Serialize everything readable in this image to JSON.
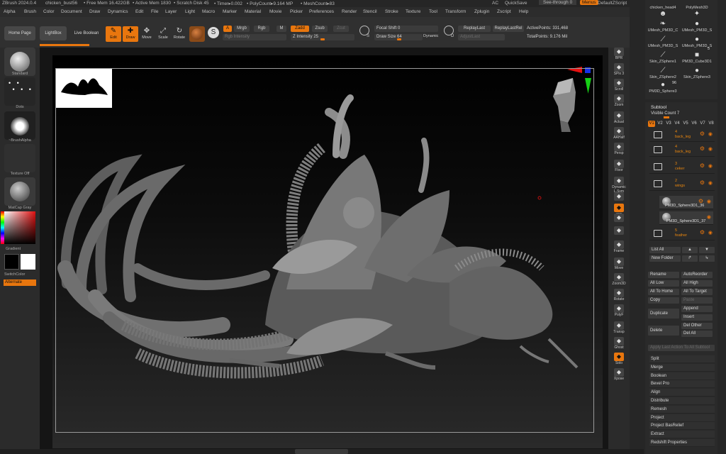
{
  "titlebar": {
    "app": "ZBrush 2024.0.4",
    "file": "chicken_bust56",
    "free_mem": "• Free Mem 16.422GB",
    "active_mem": "• Active Mem 1830",
    "scratch": "• Scratch Disk 45",
    "timer": "• Timer▸0.002",
    "polycount": "• PolyCount▸9.164 MP",
    "meshcount": "• MeshCount▸83",
    "ac": "AC",
    "quicksave": "QuickSave",
    "see_through": "See-through  0",
    "menus": "Menus",
    "zscript": "DefaultZScript"
  },
  "menubar": [
    "Alpha",
    "Brush",
    "Color",
    "Document",
    "Draw",
    "Dynamics",
    "Edit",
    "File",
    "Layer",
    "Light",
    "Macro",
    "Marker",
    "Material",
    "Movie",
    "Picker",
    "Preferences",
    "Render",
    "Stencil",
    "Stroke",
    "Texture",
    "Tool",
    "Transform",
    "Zplugin",
    "Zscript",
    "Help"
  ],
  "shelf": {
    "home_page": "Home Page",
    "lightbox": "LightBox",
    "live_boolean": "Live Boolean",
    "edit": "Edit",
    "draw": "Draw",
    "move": "Move",
    "scale": "Scale",
    "rotate": "Rotate",
    "a": "A",
    "mrgb": "Mrgb",
    "rgb": "Rgb",
    "m": "M",
    "zadd": "Zadd",
    "zsub": "Zsub",
    "zcut": "Zcut",
    "rgb_intensity": "Rgb Intensity",
    "z_intensity": "Z Intensity 25",
    "focal_shift": "Focal Shift 0",
    "draw_size": "Draw Size 64",
    "dynamic": "Dynamic",
    "replay_last": "ReplayLast",
    "replay_last_rel": "ReplayLastRel",
    "adjust_last": "AdjustLast",
    "active_points": "ActivePoints: 331,468",
    "total_points": "TotalPoints: 9.176 Mil",
    "s_label": "S",
    "d_label": "D"
  },
  "leftshelf": {
    "standard": "Standard",
    "dots": "Dots",
    "brush_alpha": "~BrushAlpha",
    "texture_off": "Texture Off",
    "matcap": "MatCap Gray",
    "gradient": "Gradient",
    "switch_color": "SwitchColor",
    "alternate": "Alternate"
  },
  "rightshelf": [
    "BPR",
    "SPix 3",
    "Scroll",
    "Zoom",
    "Actual",
    "AAHalf",
    "Persp",
    "Floor",
    "Dynamic L.Sym",
    "",
    "xyz",
    "",
    "",
    "Frame",
    "Move",
    "Zoom3D",
    "Rotate",
    "PolyF",
    "Transp",
    "Ghost",
    "Solo",
    "Xpose"
  ],
  "toolthumbs": [
    {
      "label": "chicken_head4",
      "icon": "head"
    },
    {
      "label": "PolyMesh3D",
      "icon": "star"
    },
    {
      "label": "UMesh_PM3D_C",
      "icon": "leaf"
    },
    {
      "label": "UMesh_PM3D_S",
      "icon": "sphere"
    },
    {
      "label": "UMesh_PM3D_S",
      "icon": "blade"
    },
    {
      "label": "UMesh_PM3D_S",
      "icon": "sphere"
    },
    {
      "label": "Skin_ZSphere1",
      "icon": "blade"
    },
    {
      "label": "PM3D_Cube3D1",
      "icon": "cube"
    },
    {
      "label": "Skin_ZSphere2",
      "icon": "blade"
    },
    {
      "label": "Skin_ZSphere3",
      "icon": "sphere"
    },
    {
      "label": "PM3D_Sphere3",
      "icon": "sphere"
    }
  ],
  "toolbadges": {
    "b1": "5",
    "b2": "96"
  },
  "subtool": {
    "title": "Subtool",
    "visible_count": "Visible Count  7",
    "versions": [
      "V1",
      "V2",
      "V3",
      "V4",
      "V5",
      "V6",
      "V7",
      "V8"
    ],
    "rows": [
      {
        "num": "4",
        "name": "back_leg",
        "type": "folder"
      },
      {
        "num": "4",
        "name": "back_leg",
        "type": "folder"
      },
      {
        "num": "3",
        "name": "ceker",
        "type": "folder"
      },
      {
        "num": "2",
        "name": "wings",
        "type": "folder"
      },
      {
        "num": "",
        "name": "PM3D_Sphere3D1_36",
        "type": "mesh"
      },
      {
        "num": "",
        "name": "PM3D_Sphere3D1_37",
        "type": "mesh"
      },
      {
        "num": "5",
        "name": "feather",
        "type": "folder"
      }
    ],
    "list_all": "List All",
    "new_folder": "New Folder",
    "rename": "Rename",
    "auto_reorder": "AutoReorder",
    "all_low": "All Low",
    "all_high": "All High",
    "all_to_home": "All To Home",
    "all_to_target": "All To Target",
    "copy": "Copy",
    "paste": "Paste",
    "append": "Append",
    "duplicate": "Duplicate",
    "insert": "Insert",
    "delete": "Delete",
    "del_other": "Del Other",
    "del_all": "Del All",
    "apply_last": "Apply Last Action To All Subtool",
    "menu": [
      "Split",
      "Merge",
      "Boolean",
      "Bevel Pro",
      "Align",
      "Distribute",
      "Remesh",
      "Project",
      "Project BasRelief",
      "Extract",
      "Redshift Properties"
    ]
  },
  "colors": {
    "accent": "#e8760e",
    "panel": "#2a2a2a",
    "canvas_top": "#000000",
    "canvas_bottom": "#2a2a2a"
  }
}
